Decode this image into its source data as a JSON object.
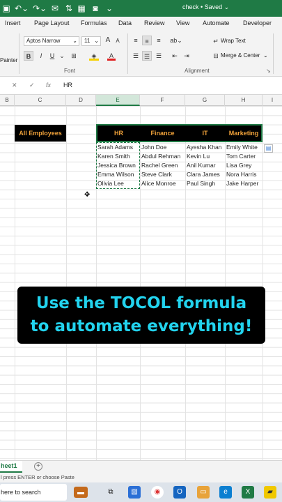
{
  "titlebar": {
    "title": "check • Saved ⌄",
    "icons": [
      "save-icon",
      "undo-icon",
      "redo-icon",
      "mail-icon",
      "sort-icon",
      "camera-icon",
      "more-icon"
    ]
  },
  "ribbon_tabs": [
    "Insert",
    "Page Layout",
    "Formulas",
    "Data",
    "Review",
    "View",
    "Automate",
    "Developer"
  ],
  "ribbon": {
    "font_name": "Aptos Narrow",
    "font_size": "11",
    "grow": "A",
    "shrink": "A",
    "bold": "B",
    "italic": "I",
    "underline": "U",
    "painter": "Painter",
    "font_group": "Font",
    "wrap_text": "Wrap Text",
    "merge_center": "Merge & Center",
    "alignment_group": "Alignment",
    "accent_color": "#1f7a45"
  },
  "formula_bar": {
    "cancel": "✕",
    "enter": "✓",
    "fx": "fx",
    "value": "HR"
  },
  "columns": [
    "B",
    "C",
    "D",
    "E",
    "F",
    "G",
    "H",
    "I"
  ],
  "sheet": {
    "all_employees": "All Employees",
    "dept_headers": [
      "HR",
      "Finance",
      "IT",
      "Marketing"
    ],
    "employees": [
      [
        "Sarah Adams",
        "John Doe",
        "Ayesha Khan",
        "Emily White"
      ],
      [
        "Karen Smith",
        "Abdul Rehman",
        "Kevin Lu",
        "Tom Carter"
      ],
      [
        "Jessica Brown",
        "Rachel Green",
        "Anil Kumar",
        "Lisa Grey"
      ],
      [
        "Emma Wilson",
        "Steve Clark",
        "Clara James",
        "Nora Harris"
      ],
      [
        "Olivia Lee",
        "Alice Monroe",
        "Paul Singh",
        "Jake Harper"
      ]
    ],
    "header_text_color": "#f0a23a"
  },
  "caption": {
    "line1": "Use the TOCOL formula",
    "line2": "to automate everything!",
    "color": "#22d3ee"
  },
  "sheet_tab": "heet1",
  "status": "l press ENTER or choose Paste",
  "taskbar": {
    "search": "here to search"
  }
}
